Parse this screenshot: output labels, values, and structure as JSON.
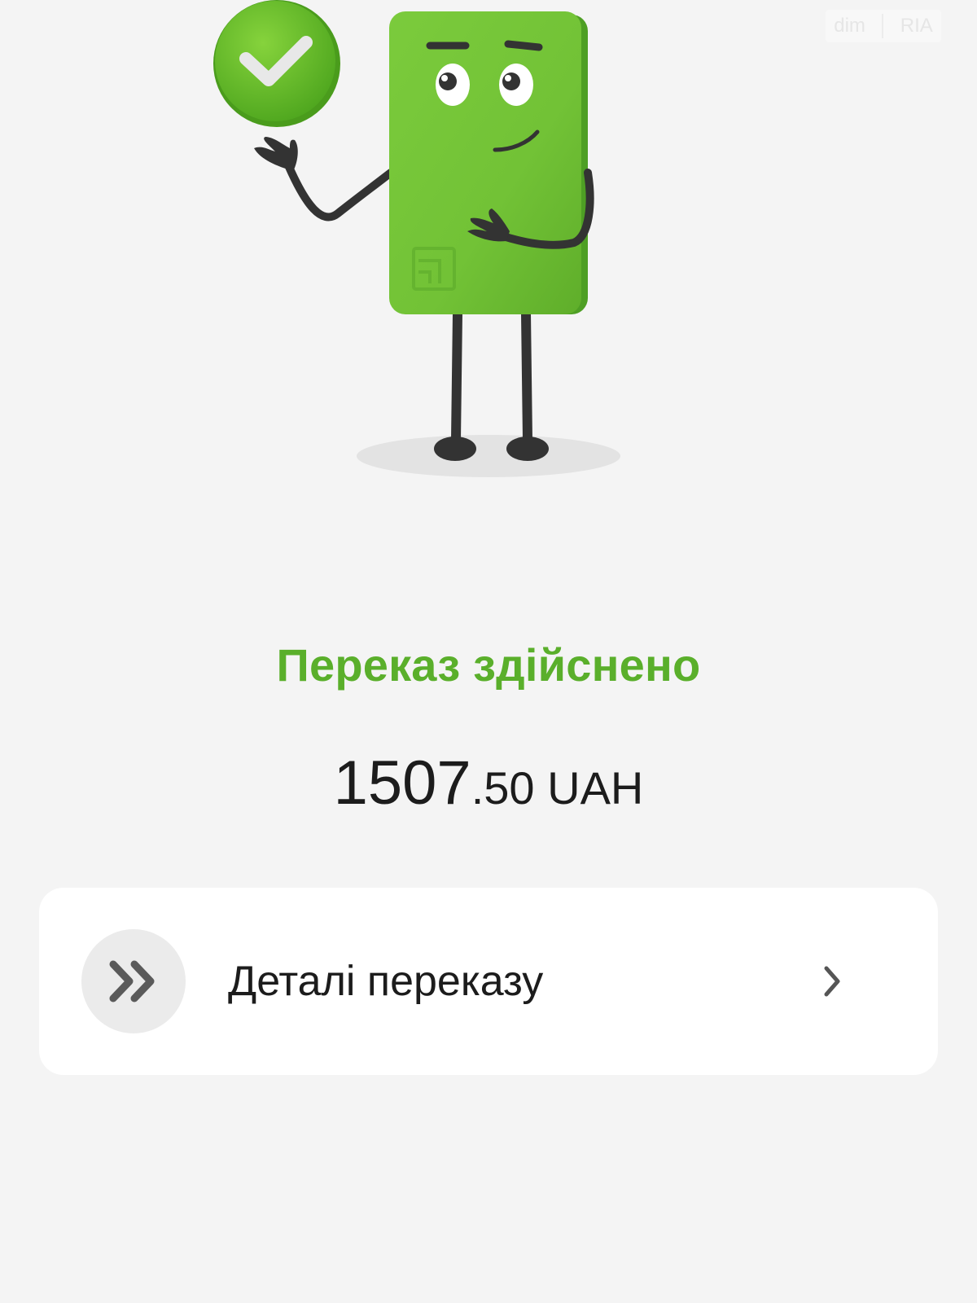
{
  "watermark": {
    "left": "dim",
    "right": "RIA"
  },
  "status": {
    "title": "Переказ здійснено"
  },
  "amount": {
    "integer": "1507",
    "fraction": ".50",
    "currency": " UAH"
  },
  "details": {
    "label": "Деталі переказу",
    "icon": "double-chevron-right-icon",
    "arrow_icon": "chevron-right-icon"
  },
  "illustration": {
    "mascot": "green-card-mascot",
    "badge_icon": "checkmark-icon"
  },
  "colors": {
    "accent": "#5aaf2b",
    "card_green": "#74c63a",
    "background": "#f4f4f4",
    "text": "#1c1c1c"
  }
}
